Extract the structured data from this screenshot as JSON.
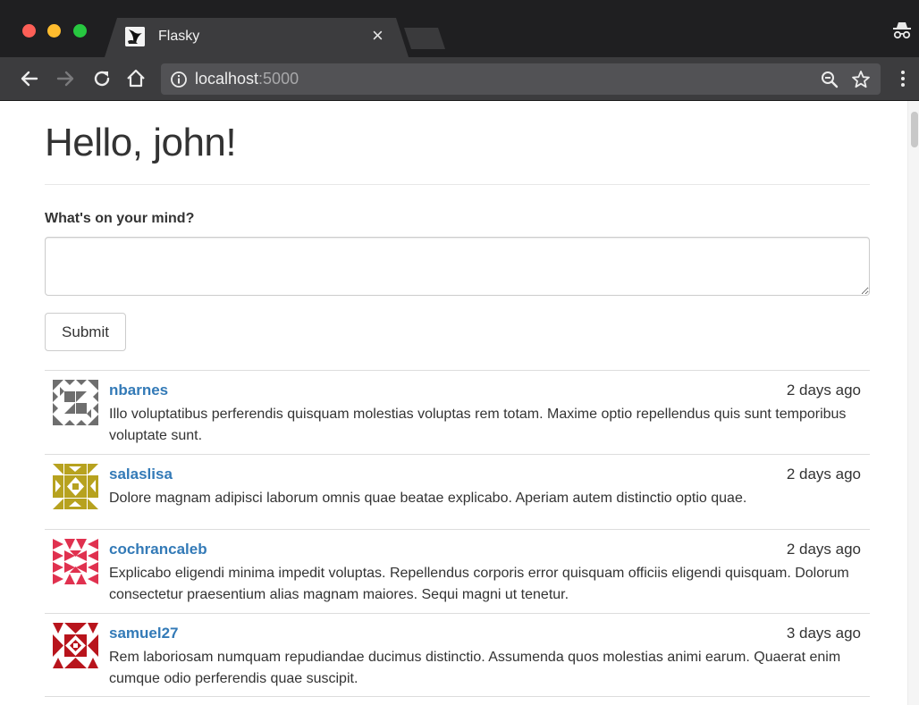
{
  "browser": {
    "tab_title": "Flasky",
    "tab_close": "×",
    "url_host": "localhost",
    "url_port": ":5000"
  },
  "page": {
    "greeting": "Hello, john!",
    "form_label": "What's on your mind?",
    "textarea_value": "",
    "submit_label": "Submit"
  },
  "posts": [
    {
      "author": "nbarnes",
      "date": "2 days ago",
      "body": "Illo voluptatibus perferendis quisquam molestias voluptas rem totam. Maxime optio repellendus quis sunt temporibus voluptate sunt.",
      "avatar_color": "#6e6e6e"
    },
    {
      "author": "salaslisa",
      "date": "2 days ago",
      "body": "Dolore magnam adipisci laborum omnis quae beatae explicabo. Aperiam autem distinctio optio quae.",
      "avatar_color": "#b7a21f"
    },
    {
      "author": "cochrancaleb",
      "date": "2 days ago",
      "body": "Explicabo eligendi minima impedit voluptas. Repellendus corporis error quisquam officiis eligendi quisquam. Dolorum consectetur praesentium alias magnam maiores. Sequi magni ut tenetur.",
      "avatar_color": "#e0314f"
    },
    {
      "author": "samuel27",
      "date": "3 days ago",
      "body": "Rem laboriosam numquam repudiandae ducimus distinctio. Assumenda quos molestias animi earum. Quaerat enim cumque odio perferendis quae suscipit.",
      "avatar_color": "#b8141c"
    }
  ],
  "colors": {
    "link": "#337ab7",
    "chrome_dark": "#1f1f21",
    "chrome_toolbar": "#3c3c3e"
  }
}
